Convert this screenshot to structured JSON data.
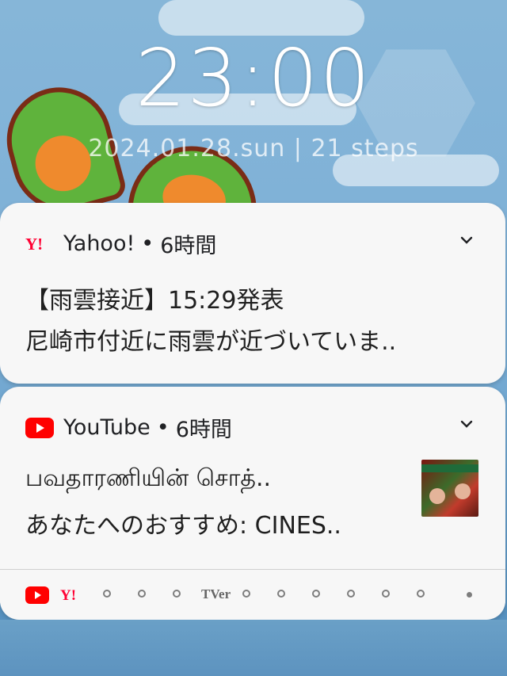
{
  "lockscreen": {
    "time": "23:00",
    "date_line": "2024.01.28.sun | 21 steps"
  },
  "notifications": [
    {
      "app": "Yahoo!",
      "separator": "•",
      "age": "6時間",
      "line1": "【雨雲接近】15:29発表",
      "line2": "尼崎市付近に雨雲が近づいていま..",
      "icon": "yahoo-logo"
    },
    {
      "app": "YouTube",
      "separator": "•",
      "age": "6時間",
      "line1": "பவதாரணியின் சொத்..",
      "line2": "あなたへのおすすめ: CINES..",
      "icon": "youtube-logo",
      "has_thumbnail": true
    }
  ],
  "tray": {
    "tver_label": "TVer",
    "icons": [
      "youtube-icon",
      "yahoo-icon",
      "chrome-icon",
      "chrome-icon",
      "chrome-icon",
      "tver-icon",
      "chrome-icon",
      "chrome-icon",
      "chrome-icon",
      "chrome-icon",
      "chrome-icon",
      "chrome-icon",
      "more-dot-icon"
    ]
  },
  "colors": {
    "youtube_red": "#ff0000",
    "yahoo_red": "#ff0033",
    "card_bg": "#f7f7f7"
  }
}
